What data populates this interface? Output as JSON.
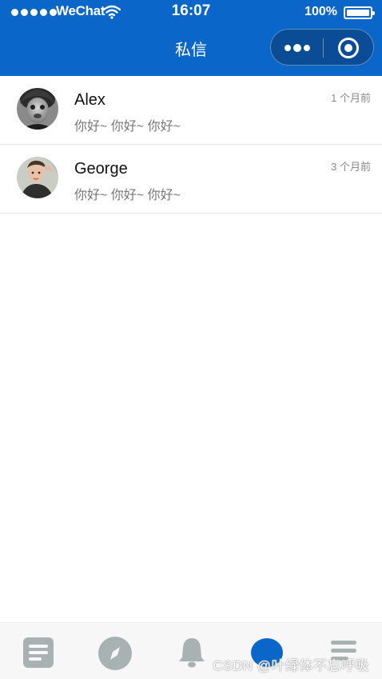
{
  "status_bar": {
    "carrier": "WeChat",
    "time": "16:07",
    "battery": "100%",
    "battery_level": 1.0
  },
  "nav": {
    "title": "私信",
    "more_icon": "more-dots-icon",
    "close_icon": "target-circle-icon"
  },
  "messages": [
    {
      "name": "Alex",
      "preview": "你好~ 你好~ 你好~",
      "time": "1 个月前",
      "avatar": "avatar-alex"
    },
    {
      "name": "George",
      "preview": "你好~ 你好~ 你好~",
      "time": "3 个月前",
      "avatar": "avatar-george"
    }
  ],
  "tabbar": {
    "tabs": [
      {
        "icon": "list-icon",
        "active": false
      },
      {
        "icon": "compass-icon",
        "active": false
      },
      {
        "icon": "bell-icon",
        "active": false
      },
      {
        "icon": "message-icon",
        "active": true
      },
      {
        "icon": "menu-icon",
        "active": false
      }
    ],
    "active_color": "#0a66c8",
    "inactive_color": "#a9b2b2"
  },
  "watermark": "CSDN @叶绿体不忘呼吸",
  "colors": {
    "brand": "#0a66c8",
    "capsule": "#0a4d96"
  }
}
